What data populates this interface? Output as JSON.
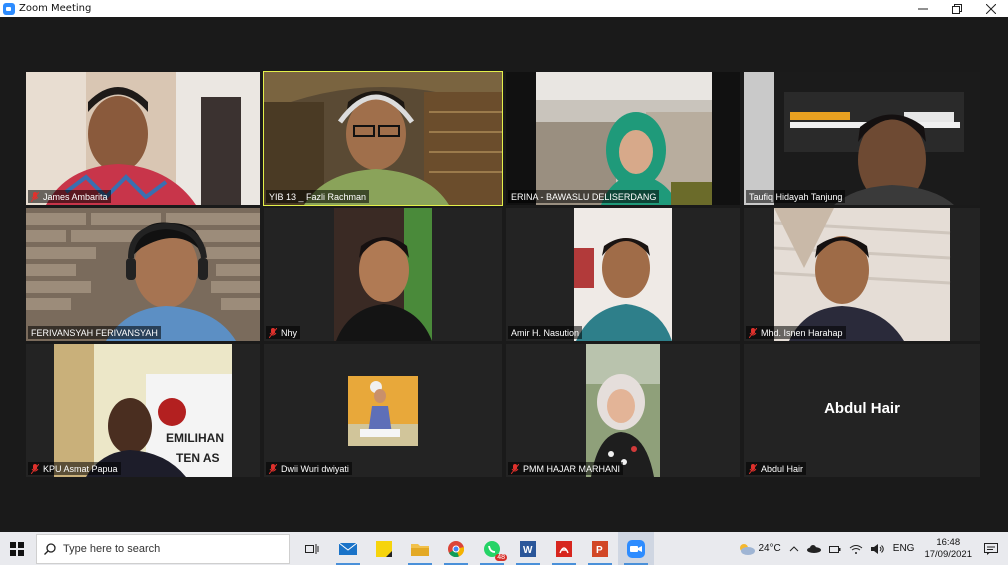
{
  "window": {
    "title": "Zoom Meeting",
    "controls": [
      "minimize-icon",
      "restore-icon",
      "close-icon"
    ]
  },
  "participants": [
    {
      "name": "James Ambarita",
      "muted": true,
      "video": true
    },
    {
      "name": "YIB 13 _ Fazli Rachman",
      "muted": false,
      "video": true,
      "active_speaker": true
    },
    {
      "name": "ERINA - BAWASLU DELISERDANG",
      "muted": false,
      "video": true
    },
    {
      "name": "Taufiq Hidayah Tanjung",
      "muted": false,
      "video": true
    },
    {
      "name": "FERIVANSYAH FERIVANSYAH",
      "muted": false,
      "video": true
    },
    {
      "name": "Nhy",
      "muted": true,
      "video": true
    },
    {
      "name": "Amir H. Nasution",
      "muted": false,
      "video": true
    },
    {
      "name": "Mhd. Isnen Harahap",
      "muted": true,
      "video": true
    },
    {
      "name": "KPU Asmat Papua",
      "muted": true,
      "video": true
    },
    {
      "name": "Dwii Wuri dwiyati",
      "muted": true,
      "video": true
    },
    {
      "name": "PMM HAJAR MARHANI",
      "muted": true,
      "video": true
    },
    {
      "name": "Abdul Hair",
      "muted": true,
      "video": false,
      "display_text": "Abdul Hair"
    }
  ],
  "taskbar": {
    "search_placeholder": "Type here to search",
    "apps": [
      "task-view-icon",
      "mail-icon",
      "sticky-notes-icon",
      "file-explorer-icon",
      "chrome-icon",
      "whatsapp-icon",
      "word-icon",
      "acrobat-icon",
      "powerpoint-icon",
      "zoom-icon"
    ],
    "whatsapp_badge": "48",
    "weather": "24°C",
    "language": "ENG",
    "time": "16:48",
    "date": "17/09/2021"
  },
  "colors": {
    "active_speaker_border": "#e4f04a",
    "muted_icon": "#e0312c",
    "zoom_blue": "#2d8cff"
  }
}
